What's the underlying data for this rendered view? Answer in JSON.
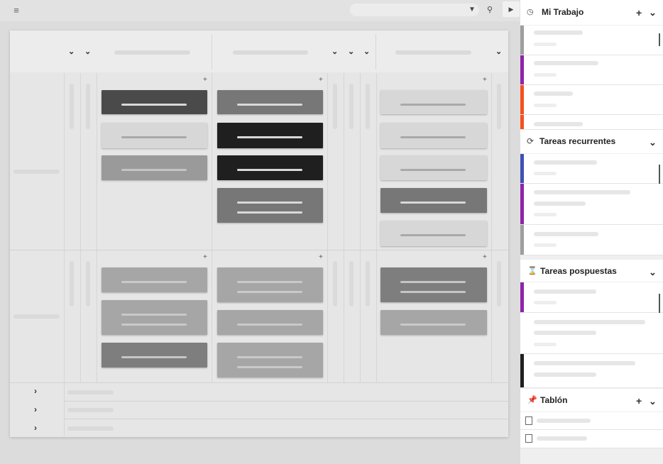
{
  "toolbar": {
    "menu_icon": "menu-icon",
    "search_icon": "search-icon",
    "filter_icon": "filter-icon",
    "panel_toggle_icon": "caret-right-icon"
  },
  "board": {
    "add_symbol": "+",
    "expand_symbol": "›"
  },
  "panel": {
    "sections": [
      {
        "title": "Mi Trabajo",
        "icon": "clock-icon",
        "has_add": true
      },
      {
        "title": "Tareas recurrentes",
        "icon": "refresh-icon",
        "has_add": false
      },
      {
        "title": "Tareas pospuestas",
        "icon": "hourglass-icon",
        "has_add": false
      },
      {
        "title": "Tablón",
        "icon": "pin-icon",
        "has_add": true
      }
    ],
    "add_symbol": "+",
    "chevron_symbol": "⌄"
  },
  "colors": {
    "purple": "#8e24aa",
    "orange": "#f4511e",
    "grey": "#9e9e9e",
    "indigo": "#3f51b5",
    "black": "#1f1f1f"
  }
}
